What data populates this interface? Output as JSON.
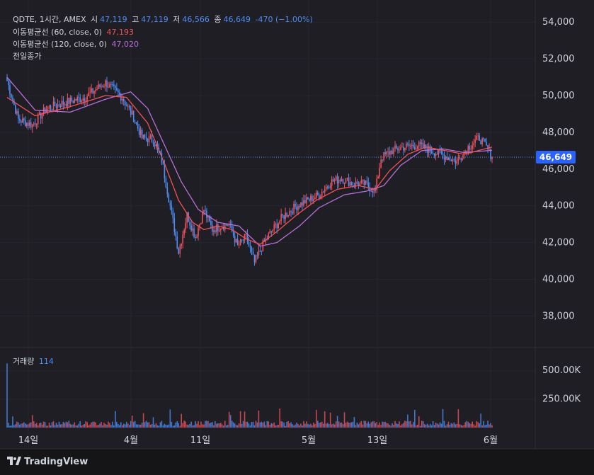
{
  "header": {
    "symbol_line": "QDTE, 1시간, AMEX",
    "open_label": "시",
    "open": "47,119",
    "high_label": "고",
    "high": "47,119",
    "low_label": "저",
    "low": "46,566",
    "close_label": "종",
    "close": "46,649",
    "change": "-470 (−1.00%)",
    "ma60_label": "이동평균선 (60, close, 0)",
    "ma60_value": "47,193",
    "ma120_label": "이동평균선 (120, close, 0)",
    "ma120_value": "47,020",
    "prev_close_label": "전일종가"
  },
  "volume_pane": {
    "label": "거래량",
    "value": "114"
  },
  "price_tag": "46,649",
  "branding": "TradingView",
  "colors": {
    "up": "#f0525a",
    "down": "#4c8df6",
    "ma60": "#f0525a",
    "ma120": "#b66fd6",
    "background": "#151518"
  },
  "chart_data": {
    "type": "candlestick",
    "price_axis": {
      "ticks": [
        38000,
        40000,
        42000,
        44000,
        46000,
        48000,
        50000,
        52000,
        54000
      ],
      "tick_labels": [
        "38,000",
        "40,000",
        "42,000",
        "44,000",
        "46,000",
        "48,000",
        "50,000",
        "52,000",
        "54,000"
      ]
    },
    "volume_axis": {
      "ticks": [
        250000,
        500000
      ],
      "tick_labels": [
        "250.00K",
        "500.00K"
      ]
    },
    "x_tick_labels": [
      "14일",
      "4월",
      "11일",
      "5월",
      "13일",
      "6월"
    ],
    "last_price": 46649,
    "close_path": [
      {
        "i": 0,
        "v": 50800
      },
      {
        "i": 8,
        "v": 48700
      },
      {
        "i": 18,
        "v": 48400
      },
      {
        "i": 28,
        "v": 49300
      },
      {
        "i": 40,
        "v": 49600
      },
      {
        "i": 55,
        "v": 49900
      },
      {
        "i": 70,
        "v": 50700
      },
      {
        "i": 82,
        "v": 49900
      },
      {
        "i": 90,
        "v": 48800
      },
      {
        "i": 96,
        "v": 47700
      },
      {
        "i": 104,
        "v": 47600
      },
      {
        "i": 110,
        "v": 46500
      },
      {
        "i": 116,
        "v": 44000
      },
      {
        "i": 122,
        "v": 41500
      },
      {
        "i": 128,
        "v": 43500
      },
      {
        "i": 134,
        "v": 42300
      },
      {
        "i": 140,
        "v": 43800
      },
      {
        "i": 146,
        "v": 42700
      },
      {
        "i": 152,
        "v": 42900
      },
      {
        "i": 158,
        "v": 43000
      },
      {
        "i": 164,
        "v": 41800
      },
      {
        "i": 170,
        "v": 42300
      },
      {
        "i": 176,
        "v": 40900
      },
      {
        "i": 182,
        "v": 41900
      },
      {
        "i": 188,
        "v": 42600
      },
      {
        "i": 196,
        "v": 43400
      },
      {
        "i": 206,
        "v": 44000
      },
      {
        "i": 214,
        "v": 44300
      },
      {
        "i": 222,
        "v": 44600
      },
      {
        "i": 230,
        "v": 45300
      },
      {
        "i": 238,
        "v": 45500
      },
      {
        "i": 246,
        "v": 45200
      },
      {
        "i": 254,
        "v": 45200
      },
      {
        "i": 262,
        "v": 44800
      },
      {
        "i": 266,
        "v": 46600
      },
      {
        "i": 274,
        "v": 47000
      },
      {
        "i": 282,
        "v": 47200
      },
      {
        "i": 292,
        "v": 47300
      },
      {
        "i": 302,
        "v": 47000
      },
      {
        "i": 312,
        "v": 46700
      },
      {
        "i": 320,
        "v": 46400
      },
      {
        "i": 328,
        "v": 47200
      },
      {
        "i": 336,
        "v": 47700
      },
      {
        "i": 340,
        "v": 47300
      },
      {
        "i": 345,
        "v": 46649
      }
    ],
    "ma60_path": [
      {
        "i": 0,
        "v": 49900
      },
      {
        "i": 20,
        "v": 48900
      },
      {
        "i": 45,
        "v": 49400
      },
      {
        "i": 70,
        "v": 50000
      },
      {
        "i": 85,
        "v": 49900
      },
      {
        "i": 100,
        "v": 48500
      },
      {
        "i": 112,
        "v": 46300
      },
      {
        "i": 122,
        "v": 44300
      },
      {
        "i": 132,
        "v": 43100
      },
      {
        "i": 140,
        "v": 42700
      },
      {
        "i": 150,
        "v": 42900
      },
      {
        "i": 160,
        "v": 42700
      },
      {
        "i": 170,
        "v": 42200
      },
      {
        "i": 180,
        "v": 41900
      },
      {
        "i": 192,
        "v": 42600
      },
      {
        "i": 206,
        "v": 43500
      },
      {
        "i": 220,
        "v": 44300
      },
      {
        "i": 235,
        "v": 44900
      },
      {
        "i": 250,
        "v": 45100
      },
      {
        "i": 262,
        "v": 44900
      },
      {
        "i": 272,
        "v": 45900
      },
      {
        "i": 285,
        "v": 46800
      },
      {
        "i": 298,
        "v": 47200
      },
      {
        "i": 312,
        "v": 47000
      },
      {
        "i": 325,
        "v": 46800
      },
      {
        "i": 335,
        "v": 47000
      },
      {
        "i": 345,
        "v": 47193
      }
    ],
    "ma120_path": [
      {
        "i": 0,
        "v": 51000
      },
      {
        "i": 20,
        "v": 49200
      },
      {
        "i": 45,
        "v": 49100
      },
      {
        "i": 70,
        "v": 49800
      },
      {
        "i": 88,
        "v": 50200
      },
      {
        "i": 100,
        "v": 49300
      },
      {
        "i": 112,
        "v": 47300
      },
      {
        "i": 124,
        "v": 45300
      },
      {
        "i": 136,
        "v": 43800
      },
      {
        "i": 150,
        "v": 43100
      },
      {
        "i": 165,
        "v": 42900
      },
      {
        "i": 180,
        "v": 41800
      },
      {
        "i": 192,
        "v": 42000
      },
      {
        "i": 208,
        "v": 42900
      },
      {
        "i": 222,
        "v": 43900
      },
      {
        "i": 240,
        "v": 44600
      },
      {
        "i": 256,
        "v": 44800
      },
      {
        "i": 268,
        "v": 45100
      },
      {
        "i": 280,
        "v": 46200
      },
      {
        "i": 295,
        "v": 47000
      },
      {
        "i": 310,
        "v": 47100
      },
      {
        "i": 325,
        "v": 46900
      },
      {
        "i": 345,
        "v": 47020
      }
    ],
    "n_bars": 346
  }
}
